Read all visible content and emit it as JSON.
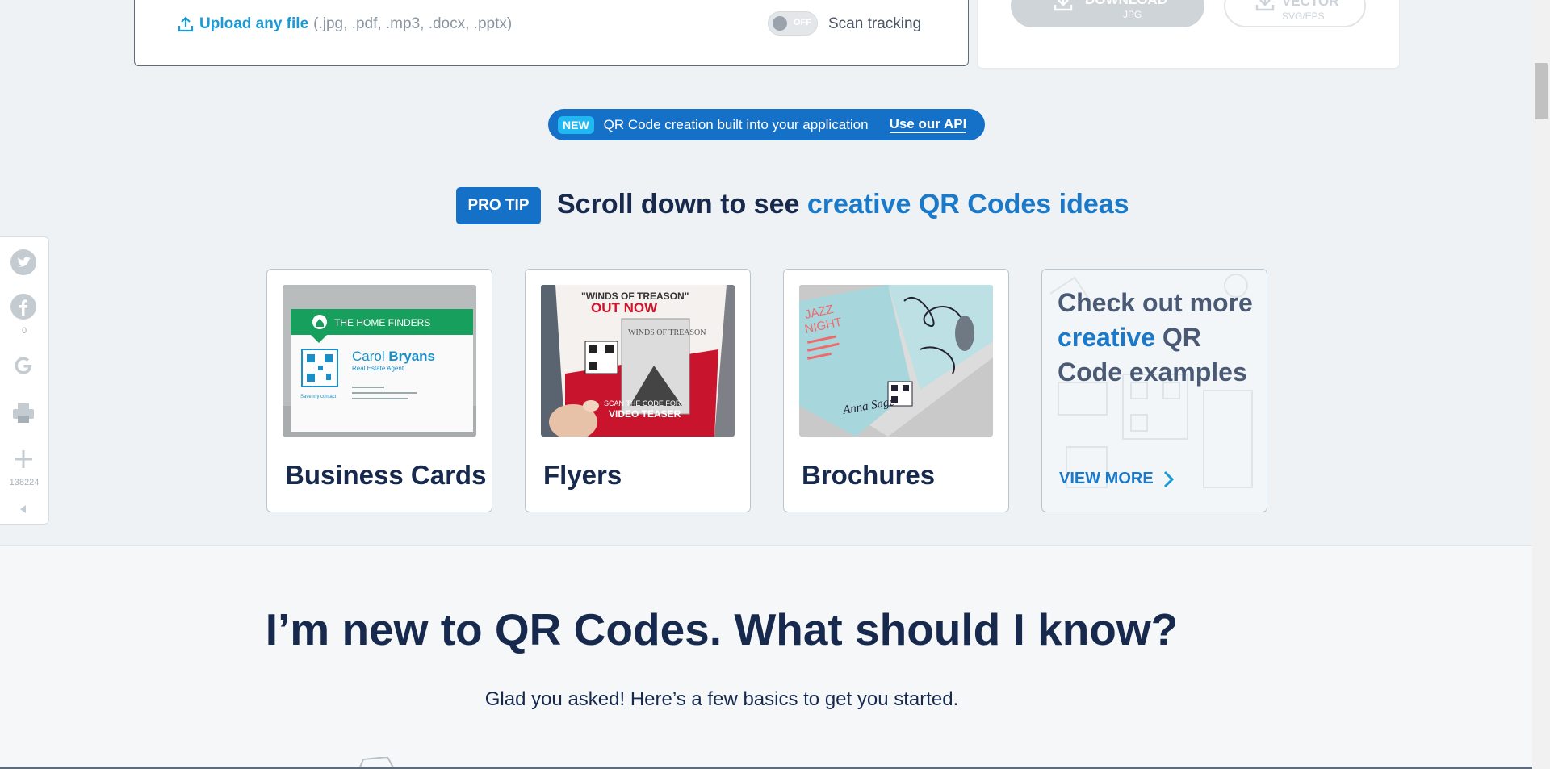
{
  "upload": {
    "link_label": "Upload any file",
    "extensions": "(.jpg, .pdf, .mp3, .docx, .pptx)",
    "toggle_state": "OFF",
    "scan_tracking_label": "Scan tracking"
  },
  "download": {
    "download_label": "DOWNLOAD",
    "download_sub": "JPG",
    "vector_label": "VECTOR",
    "vector_sub": "SVG/EPS"
  },
  "api_banner": {
    "badge": "NEW",
    "text": "QR Code creation built into your application",
    "link": "Use our API"
  },
  "pro_tip": {
    "badge": "PRO TIP",
    "text_prefix": "Scroll down to see ",
    "text_highlight": "creative QR Codes ideas"
  },
  "cards": [
    {
      "title": "Business Cards"
    },
    {
      "title": "Flyers"
    },
    {
      "title": "Brochures"
    }
  ],
  "card_images": {
    "business": {
      "brand": "THE HOME FINDERS",
      "first": "Carol",
      "last": "Bryans",
      "role": "Real Estate Agent",
      "qr_caption": "Save my contact"
    },
    "flyer": {
      "quote": "\"WINDS OF TREASON\"",
      "out_now": "OUT NOW",
      "book_title": "WINDS OF TREASON",
      "scan_line": "SCAN THE CODE FOR",
      "teaser": "VIDEO TEASER"
    },
    "brochure": {
      "line1": "JAZZ",
      "line2": "NIGHT",
      "sign": "Anna Sage"
    }
  },
  "more_card": {
    "line_prefix": "Check out more ",
    "highlight": "creative",
    "line_suffix": " QR Code examples",
    "view_more": "VIEW MORE"
  },
  "social": {
    "facebook_count": "0",
    "share_count": "138224",
    "icons": [
      "twitter-icon",
      "facebook-icon",
      "google-icon",
      "print-icon",
      "plus-icon",
      "collapse-icon"
    ]
  },
  "faq": {
    "heading": "I’m new to QR Codes. What should I know?",
    "subheading": "Glad you asked! Here’s a few basics to get you started."
  },
  "colors": {
    "brand_blue": "#1570c8",
    "link_blue": "#1a9bd7",
    "navy": "#17294d",
    "background": "#eef2f4"
  }
}
